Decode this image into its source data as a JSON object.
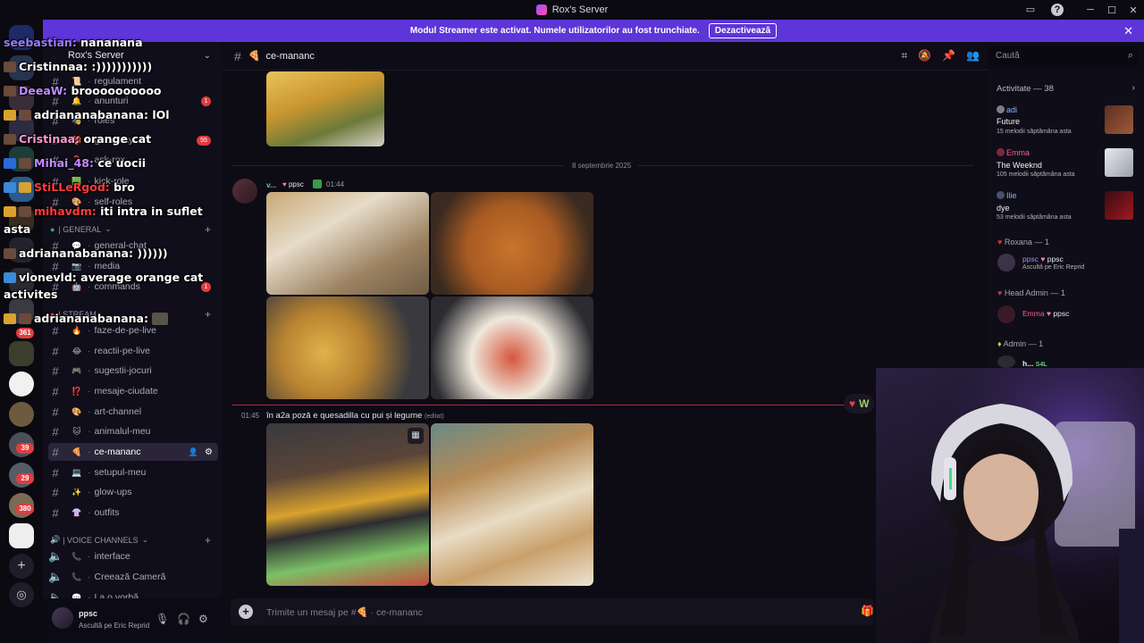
{
  "window": {
    "title": "Rox's Server"
  },
  "banner": {
    "text": "Modul Streamer este activat. Numele utilizatorilor au fost trunchiate.",
    "button": "Dezactivează"
  },
  "server": {
    "name": "Rox's Server"
  },
  "rail_badges": [
    "361",
    "39",
    "29",
    "380"
  ],
  "channels_top": [
    {
      "name": "regulament",
      "emoji": "📜"
    },
    {
      "name": "anunturi",
      "emoji": "🔔",
      "badge": "1"
    },
    {
      "name": "roles",
      "emoji": "🎭"
    },
    {
      "name": "giveaway",
      "emoji": "🎁",
      "badge": "55"
    },
    {
      "name": "ask-rox",
      "emoji": "❓"
    },
    {
      "name": "kick-role",
      "emoji": "🟩"
    },
    {
      "name": "self-roles",
      "emoji": "🎨"
    }
  ],
  "category_general": "| GENERAL",
  "channels_general": [
    {
      "name": "general-chat",
      "emoji": "💬"
    },
    {
      "name": "media",
      "emoji": "📷"
    },
    {
      "name": "commands",
      "emoji": "🤖",
      "badge": "1"
    }
  ],
  "category_stream": "| STREAM",
  "channels_stream": [
    {
      "name": "faze-de-pe-live",
      "emoji": "🔥"
    },
    {
      "name": "reactii-pe-live",
      "emoji": "😂"
    },
    {
      "name": "sugestii-jocuri",
      "emoji": "🎮"
    },
    {
      "name": "mesaje-ciudate",
      "emoji": "⁉️"
    },
    {
      "name": "art-channel",
      "emoji": "🎨"
    },
    {
      "name": "animalul-meu",
      "emoji": "🐱"
    },
    {
      "name": "ce-mananc",
      "emoji": "🍕"
    },
    {
      "name": "setupul-meu",
      "emoji": "💻"
    },
    {
      "name": "glow-ups",
      "emoji": "✨"
    },
    {
      "name": "outfits",
      "emoji": "👚"
    }
  ],
  "category_voice": "| VOICE CHANNELS",
  "channels_voice": [
    {
      "name": "interface",
      "emoji": "📞"
    },
    {
      "name": "Creează Cameră",
      "emoji": "📞"
    },
    {
      "name": "La o vorbă",
      "emoji": "💬"
    }
  ],
  "user": {
    "name": "ppsc",
    "status": "Ascultă pe Eric Reprid"
  },
  "header": {
    "channel": "ce-mananc"
  },
  "search": {
    "placeholder": "Caută"
  },
  "messages": {
    "date_divider": "8 septembrie 2025",
    "author": "v...",
    "author_tag": "ppsc",
    "time": "01:44",
    "followup_time": "01:45",
    "followup_text": "în a2a poză e quesadilla cu pui și legume",
    "edited": "(editat)"
  },
  "composer": {
    "placeholder": "Trimite un mesaj pe #🍕 · ce-mananc"
  },
  "activity": {
    "title": "Activitate — 38",
    "items": [
      {
        "user": "adi",
        "track": "Future",
        "stat": "15 melodii săptămâna asta",
        "color": "#8ab4ff"
      },
      {
        "user": "Emma",
        "track": "The Weeknd",
        "stat": "105 melodii săptămâna asta",
        "color": "#ff5c8a"
      },
      {
        "user": "Ilie",
        "track": "dye",
        "stat": "53 melodii săptămâna asta",
        "color": "#8ab4ff"
      }
    ],
    "roles": [
      {
        "role": "Roxana — 1",
        "member": "ppsc",
        "tag": "ppsc",
        "status": "Ascultă pe Eric Reprid"
      },
      {
        "role": "Head Admin — 1",
        "member": "Emma",
        "tag": "ppsc"
      },
      {
        "role": "Admin — 1",
        "member": "h...",
        "tag": "S4L"
      }
    ]
  },
  "chat_overlay": [
    {
      "user": "seebastian:",
      "msg": "nananana",
      "color": "#9b7cff"
    },
    {
      "user": "Cristinnaa:",
      "msg": ":)))))))))))",
      "color": "#ffffff"
    },
    {
      "user": "DeeaW:",
      "msg": "broooooooooo",
      "color": "#c08cff"
    },
    {
      "user": "adriananabanana:",
      "msg": "lOl",
      "color": "#ffffff"
    },
    {
      "user": "Cristinaa:",
      "msg": "orange cat",
      "color": "#ff9bd1"
    },
    {
      "user": "Mihai_48:",
      "msg": "ce uocii",
      "color": "#c08cff"
    },
    {
      "user": "StiLLeRgod:",
      "msg": "bro",
      "color": "#ff3b3b"
    },
    {
      "user": "mihavdm:",
      "msg": "iti intra in suflet",
      "color": "#ff3b3b"
    },
    {
      "user": "",
      "msg": "asta",
      "color": "#ffffff"
    },
    {
      "user": "adriananabanana:",
      "msg": "))))))",
      "color": "#ffffff"
    },
    {
      "user": "vlonevld:",
      "msg": "average orange cat",
      "color": "#ffffff"
    },
    {
      "user": "",
      "msg": "activites",
      "color": "#ffffff"
    },
    {
      "user": "adriananabanana:",
      "msg": "",
      "color": "#ffffff"
    }
  ],
  "follow_pill": "W"
}
